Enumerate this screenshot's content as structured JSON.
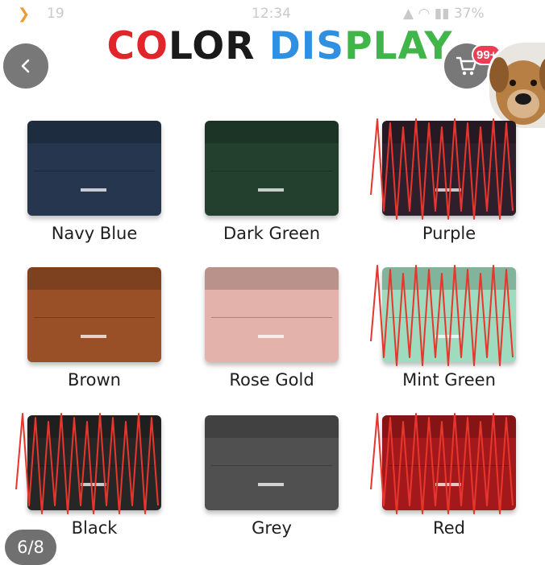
{
  "status_bar": {
    "notifications": "19",
    "clock": "12:34",
    "battery": "37%"
  },
  "header": {
    "title_part1": "CO",
    "title_part2": "LOR ",
    "title_part3": "DIS",
    "title_part4": "PLAY",
    "cart_badge": "99+",
    "title_colors": [
      "#e0262b",
      "#1a1a1a",
      "#2f8fe0",
      "#3fb54a"
    ]
  },
  "colors": [
    {
      "name": "Navy Blue",
      "swatch": "#25364e",
      "crossed_out": false
    },
    {
      "name": "Dark Green",
      "swatch": "#23402f",
      "crossed_out": false
    },
    {
      "name": "Purple",
      "swatch": "#2e1f2c",
      "crossed_out": true
    },
    {
      "name": "Brown",
      "swatch": "#9a5027",
      "crossed_out": false
    },
    {
      "name": "Rose Gold",
      "swatch": "#e3b3ab",
      "crossed_out": false
    },
    {
      "name": "Mint Green",
      "swatch": "#9fdcbf",
      "crossed_out": true
    },
    {
      "name": "Black",
      "swatch": "#262626",
      "crossed_out": true
    },
    {
      "name": "Grey",
      "swatch": "#505050",
      "crossed_out": false
    },
    {
      "name": "Red",
      "swatch": "#a3191b",
      "crossed_out": true
    }
  ],
  "page_indicator": "6/8",
  "icons": {
    "back": "chevron-left-icon",
    "cart": "shopping-cart-icon",
    "avatar": "dog-avatar"
  }
}
